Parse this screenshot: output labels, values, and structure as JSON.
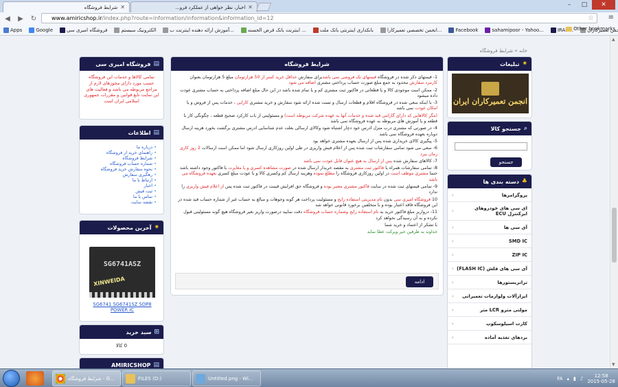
{
  "browser": {
    "tabs": [
      {
        "label": "شرایط فروشگاه",
        "active": true
      },
      {
        "label": "اخبار، نظر خواهی از عملکرد فرو...",
        "active": false
      }
    ],
    "url_host": "www.amiricshop.ir",
    "url_path": "/index.php?route=information/information&information_id=12",
    "bookmarks": [
      {
        "label": "Apps"
      },
      {
        "label": "Google"
      },
      {
        "label": "فروشگاه امیری سی"
      },
      {
        "label": "الکترونیک سیستم"
      },
      {
        "label": "آموزش ارائه دهنده اینترنت ب..."
      },
      {
        "label": "اینترنت بانک قرض الحسنه ..."
      },
      {
        "label": "بانکداری اینترنتی بانک ملت"
      },
      {
        "label": "انجمن تخصصی تعمیرکارا..."
      },
      {
        "label": "Facebook"
      },
      {
        "label": "sahamipoor - Yahoo..."
      },
      {
        "label": "IRAN..."
      },
      {
        "label": "انجمن تعمیرکاران..."
      }
    ],
    "other_bookmarks": "Other bookmarks"
  },
  "breadcrumb": "خانه » شرایط فروشگاه",
  "main": {
    "title": "شرایط فروشگاه",
    "terms": [
      {
        "parts": [
          {
            "t": "1- قیمتهای ذکر شده در فروشگاه "
          },
          {
            "t": "قیمتهای تک فروشی نمی باشد",
            "c": "red"
          },
          {
            "t": "برای سفارش "
          },
          {
            "t": "حداقل خرید کمتر از 50 هزارتومان",
            "c": "red"
          },
          {
            "t": " مبلغ 5 هزارتومان بعنوان "
          },
          {
            "t": "کارمزد سفارش",
            "c": "red"
          },
          {
            "t": " محدود به جمع مبلغ صورت حساب پرداختی مشتری "
          },
          {
            "t": "اضافه می شود",
            "c": "red"
          }
        ]
      },
      {
        "parts": [
          {
            "t": "2- ممکن است موجودی کالا و یا قطعاتی در فاکتور ثبت مشتری کم و یا تمام شده باشد در این حال مبلغ اضافه پرداختی به حساب مشتری عودت داده میشود"
          }
        ]
      },
      {
        "parts": [
          {
            "t": "3- با اینکه سعی شده در فروشگاه اقلام و قطعات ارسال و تست شده ارائه شود سفارش و خرید مشتری "
          },
          {
            "t": "کارایی",
            "c": "red"
          },
          {
            "t": " ، خدمات پس از فروش و یا "
          },
          {
            "t": "امکان عودت",
            "c": "red"
          },
          {
            "t": " نمی باشد"
          }
        ]
      },
      {
        "parts": [
          {
            "t": "(مگر کالاهایی که دارای گارانتی قید شده و خدمات آنها به عهده شرکت مربوطه است)",
            "c": "red"
          },
          {
            "t": " و مسئولیتی از باب کارکرد صحیح قطعه ، چگونگی کار با قطعه و یا آموزش های مربوطه به عهده فروشگاه نمی باشد"
          }
        ]
      },
      {
        "parts": [
          {
            "t": "4- در صورتی که مشتری درب منزل ادرس خود دچار اشتباه شود وکالای ارسالی بعلت عدم شناسایی ادرس مشتری برگشت بخورد هزینه ارسال دوباره بعهده فروشگاه نمی باشد"
          }
        ]
      },
      {
        "parts": [
          {
            "t": "5- پیگیری کالای خریداری شده پس از ارسال بعهده مشتری خواهد بود"
          }
        ]
      },
      {
        "parts": [
          {
            "t": "6- سعی می شود تمامی سفارشات ثبت شده پس از اعلام فیش واریزی در طی اولین روزکاری ارسال شود اما ممکن است ارسالات "
          },
          {
            "t": "2 روز کاری زمان ببرد",
            "c": "red"
          }
        ]
      },
      {
        "parts": [
          {
            "t": "7- کالاهای سفارش شده "
          },
          {
            "t": "پس از ارسال به هیچ عنوان قابل عودت نمی باشد",
            "c": "red"
          }
        ]
      },
      {
        "parts": [
          {
            "t": "8- تمامی سفارشات همراه با "
          },
          {
            "t": "فاکتور ثبت مشتری",
            "c": "red"
          },
          {
            "t": " به مقصد خریدار ارسال شده در "
          },
          {
            "t": "صورت مشاهده کسری و یا مغایرت",
            "c": "red"
          },
          {
            "t": " با فاکتور وجود داشته باشد حتما "
          },
          {
            "t": "مشتری موظف است",
            "c": "red"
          },
          {
            "t": " در اولین روزکاری فروشگاه را "
          },
          {
            "t": "مطلع نموده",
            "c": "red"
          },
          {
            "t": " وهزینه ارسال کم وکسری کالا و یا عودت مبلغ کسری "
          },
          {
            "t": "بعهده فروشگاه می باشد",
            "c": "red"
          }
        ]
      },
      {
        "parts": [
          {
            "t": "9- تمامی قیمتهای ثبت شده در سایت "
          },
          {
            "t": "فاکتور مشتری معتبر بوده",
            "c": "red"
          },
          {
            "t": " و فروشگاه حق افزایش قیمت در فاکتور ثبت شده پس "
          },
          {
            "t": "از اعلام فیش واریزی",
            "c": "red"
          },
          {
            "t": " را ندارد"
          }
        ]
      },
      {
        "parts": [
          {
            "t": "10 "
          },
          {
            "t": "فروشگاه امیری سی",
            "c": "red"
          },
          {
            "t": " بدون "
          },
          {
            "t": "نام مدیریتی استفاده رایج",
            "c": "red"
          },
          {
            "t": " و مسئولیت پرداخت هر گونه وجوهات و مبالغ به حساب غیر از شماره حساب قید شده در این فروشگاه فاقد اعتبار بوده و با متخلفین برخورد قانونی خواهد شد"
          }
        ]
      },
      {
        "parts": [
          {
            "t": "11- درواریز مبلغ فاکتور خرید به "
          },
          {
            "t": "نام استفاده رایج وشماره حساب فروشگاه",
            "c": "red"
          },
          {
            "t": " دقت نمایید درصورت واریز بغیر فروشگاه هیچ گونه مسئولیتی قبول نکرده و به آن رسیدگی نخواهد کرد"
          }
        ]
      },
      {
        "parts": [
          {
            "t": "با تشکر از اعتماد و خرید شما"
          }
        ]
      },
      {
        "parts": [
          {
            "t": "خداوند به طرفین خیر وبرکت عطا نماید",
            "c": "green"
          }
        ]
      }
    ],
    "back_button": "ادامه"
  },
  "right": {
    "ads_title": "تبلیغات",
    "ads_banner_text": "انجمن تعمیرکاران ایران",
    "search_title": "جستجو کالا",
    "search_placeholder": "",
    "search_button": "جستجو",
    "categories_title": "دسته بندی ها",
    "categories": [
      "پروگرامرها",
      "ای سی های خودروهای ایزکنترل ECU",
      "آی سی ها",
      "SMD IC",
      "ZIP IC",
      "آی سی های فلش (FLASH IC)",
      "ترانزیستورها",
      "ابزارآلات ولوازمات تعمیراتی",
      "مولتی مترو LCR متر",
      "کارت اسیلوسکوپ",
      "بردهای تغذیه آماده"
    ]
  },
  "left": {
    "store_title": "فروشگاه امیری سی",
    "store_text": "تمامی کالاها و خدمات این فروشگاه حسب مورد دارای مجوزهای لازم از مراجع مربوطه می باشد و فعالیت های این سایت تابع قوانین و مقررات جمهوری اسلامی ایران است",
    "info_title": "اطلاعات",
    "info_links": [
      "درباره ما",
      "راهنمای خرید از فروشگاه",
      "شرایط فروشگاه",
      "شماره حساب فروشگاه",
      "نحوه سفارش خرید فروشگاه",
      "رهگیری سفارش",
      "ارتباط با ما",
      "اخبار",
      "ثبت فیش",
      "تماس با ما",
      "نقشه سایت"
    ],
    "latest_title": "آخرین محصولات",
    "latest_chip_label": "SG6741ASZ",
    "latest_watermark": "XINWEIDA",
    "latest_product": "SG6741 SG6741SZ SOP8 POWER IC",
    "cart_title": "سبد خرید",
    "cart_text": "0 کالا",
    "shop_title": "AMIRICSHOP"
  },
  "taskbar": {
    "items": [
      {
        "label": "شرایط فروشگاه - G...",
        "active": true
      },
      {
        "label": "FILES (D:)",
        "active": false
      },
      {
        "label": "Untitled.png - Wi...",
        "active": false
      }
    ],
    "lang": "FA",
    "time": "12:58",
    "date": "2015-05-28"
  }
}
